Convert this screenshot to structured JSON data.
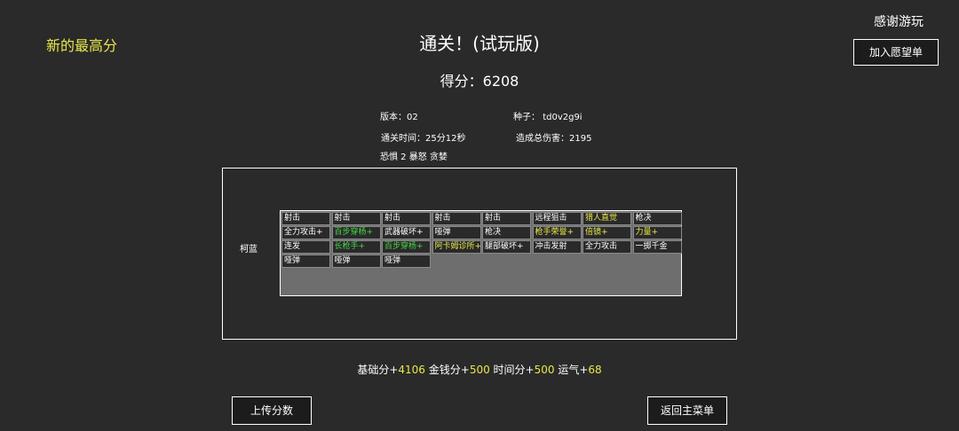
{
  "header": {
    "new_high_score": "新的最高分",
    "title": "通关！(试玩版)",
    "score_label": "得分：",
    "score_value": "6208",
    "thanks": "感谢游玩",
    "wishlist_button": "加入愿望单"
  },
  "run_info": {
    "version_label": "版本：",
    "version_value": "02",
    "seed_label": "种子：",
    "seed_value": "td0v2g9i",
    "clear_time_label": "通关时间：",
    "clear_time_value": "25分12秒",
    "total_damage_label": "造成总伤害：",
    "total_damage_value": "2195",
    "modifiers": "恐惧 2 暴怒 贪婪"
  },
  "character": {
    "name": "柯蓝",
    "rows": [
      [
        {
          "text": "射击",
          "color": "#ffffff"
        },
        {
          "text": "射击",
          "color": "#ffffff"
        },
        {
          "text": "射击",
          "color": "#ffffff"
        },
        {
          "text": "射击",
          "color": "#ffffff"
        },
        {
          "text": "射击",
          "color": "#ffffff"
        },
        {
          "text": "远程狙击",
          "color": "#ffffff"
        },
        {
          "text": "猎人直觉",
          "color": "#e8e84a"
        },
        {
          "text": "枪决",
          "color": "#ffffff"
        }
      ],
      [
        {
          "text": "全力攻击+",
          "color": "#ffffff"
        },
        {
          "text": "百步穿杨+",
          "color": "#46d646"
        },
        {
          "text": "武器破坏+",
          "color": "#ffffff"
        },
        {
          "text": "哑弹",
          "color": "#ffffff"
        },
        {
          "text": "枪决",
          "color": "#ffffff"
        },
        {
          "text": "枪手荣誉+",
          "color": "#e8e84a"
        },
        {
          "text": "倍镜+",
          "color": "#e8e84a"
        },
        {
          "text": "力量+",
          "color": "#e8e84a"
        }
      ],
      [
        {
          "text": "连发",
          "color": "#ffffff"
        },
        {
          "text": "长枪手+",
          "color": "#46d646"
        },
        {
          "text": "百步穿杨+",
          "color": "#46d646"
        },
        {
          "text": "阿卡姆诊所+",
          "color": "#e8e84a"
        },
        {
          "text": "腿部破坏+",
          "color": "#ffffff"
        },
        {
          "text": "冲击发射",
          "color": "#ffffff"
        },
        {
          "text": "全力攻击",
          "color": "#ffffff"
        },
        {
          "text": "一掷千金",
          "color": "#ffffff"
        }
      ],
      [
        {
          "text": "哑弹",
          "color": "#ffffff"
        },
        {
          "text": "哑弹",
          "color": "#ffffff"
        },
        {
          "text": "哑弹",
          "color": "#ffffff"
        }
      ]
    ]
  },
  "bonus": {
    "base_label": "基础分+",
    "base_value": "4106",
    "gold_label": "金钱分+",
    "gold_value": "500",
    "time_label": "时间分+",
    "time_value": "500",
    "luck_label": "运气+",
    "luck_value": "68"
  },
  "buttons": {
    "upload": "上传分数",
    "back": "返回主菜单"
  },
  "colors": {
    "background": "#2a2a2a",
    "highlight_yellow": "#e8e84a",
    "highlight_green": "#46d646"
  }
}
